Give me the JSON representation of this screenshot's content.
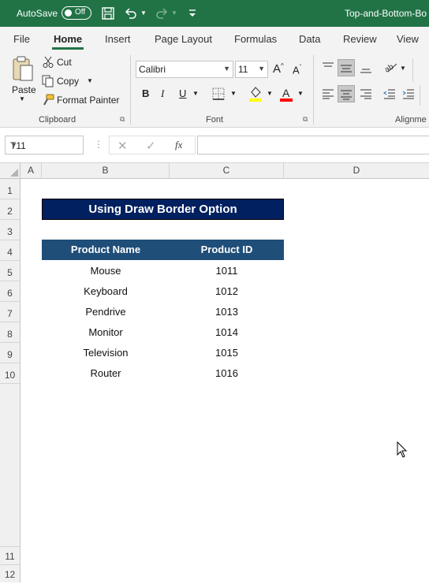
{
  "titlebar": {
    "autosave_label": "AutoSave",
    "autosave_state": "Off",
    "document_title": "Top-and-Bottom-Bo",
    "accent": "#217346"
  },
  "ribbon_tabs": [
    "File",
    "Home",
    "Insert",
    "Page Layout",
    "Formulas",
    "Data",
    "Review",
    "View"
  ],
  "active_tab": "Home",
  "clipboard": {
    "paste_label": "Paste",
    "cut_label": "Cut",
    "copy_label": "Copy",
    "format_painter_label": "Format Painter",
    "group_label": "Clipboard"
  },
  "font": {
    "family": "Calibri",
    "size": "11",
    "bold": "B",
    "italic": "I",
    "underline": "U",
    "group_label": "Font",
    "fill_color": "#ffff00",
    "font_color": "#ff0000"
  },
  "alignment": {
    "group_label": "Alignme"
  },
  "formula_bar": {
    "name_box": "T11",
    "fx_label": "fx",
    "formula": ""
  },
  "columns": [
    "A",
    "B",
    "C",
    "D"
  ],
  "rows": [
    "1",
    "2",
    "3",
    "4",
    "5",
    "6",
    "7",
    "8",
    "9",
    "10",
    "11",
    "12"
  ],
  "sheet": {
    "title": "Using Draw Border Option",
    "headers": [
      "Product Name",
      "Product ID"
    ],
    "rows": [
      [
        "Mouse",
        "1011"
      ],
      [
        "Keyboard",
        "1012"
      ],
      [
        "Pendrive",
        "1013"
      ],
      [
        "Monitor",
        "1014"
      ],
      [
        "Television",
        "1015"
      ],
      [
        "Router",
        "1016"
      ]
    ],
    "title_fill": "#002060",
    "header_fill": "#1f4e79"
  }
}
